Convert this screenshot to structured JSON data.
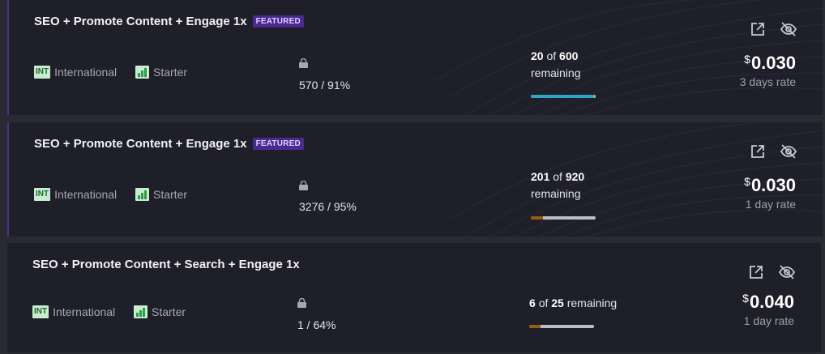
{
  "offers": [
    {
      "title": "SEO + Promote Content + Engage 1x",
      "featured": true,
      "badge": "FEATURED",
      "region_code": "INT",
      "region": "International",
      "tier": "Starter",
      "members": "570 / 91%",
      "remaining_count": "20",
      "remaining_of": "of",
      "remaining_total": "600",
      "remaining_label": "remaining",
      "progress": 0.97,
      "progress_color": "#2fa3c4",
      "currency": "$",
      "price": "0.030",
      "rate_label": "3 days rate"
    },
    {
      "title": "SEO + Promote Content + Engage 1x",
      "featured": true,
      "badge": "FEATURED",
      "region_code": "INT",
      "region": "International",
      "tier": "Starter",
      "members": "3276 / 95%",
      "remaining_count": "201",
      "remaining_of": "of",
      "remaining_total": "920",
      "remaining_label": "remaining",
      "progress": 0.19,
      "progress_color": "#9a5a12",
      "currency": "$",
      "price": "0.030",
      "rate_label": "1 day rate"
    },
    {
      "title": "SEO + Promote Content + Search + Engage 1x",
      "featured": false,
      "badge": "",
      "region_code": "INT",
      "region": "International",
      "tier": "Starter",
      "members": "1 / 64%",
      "remaining_count": "6",
      "remaining_of": "of",
      "remaining_total": "25",
      "remaining_label": "remaining",
      "progress": 0.17,
      "progress_color": "#9a5a12",
      "currency": "$",
      "price": "0.040",
      "rate_label": "1 day rate"
    }
  ],
  "icons": {
    "external": "external-link-icon",
    "hide": "eye-off-icon",
    "lock": "lock-icon",
    "tier": "bar-chart-icon"
  }
}
